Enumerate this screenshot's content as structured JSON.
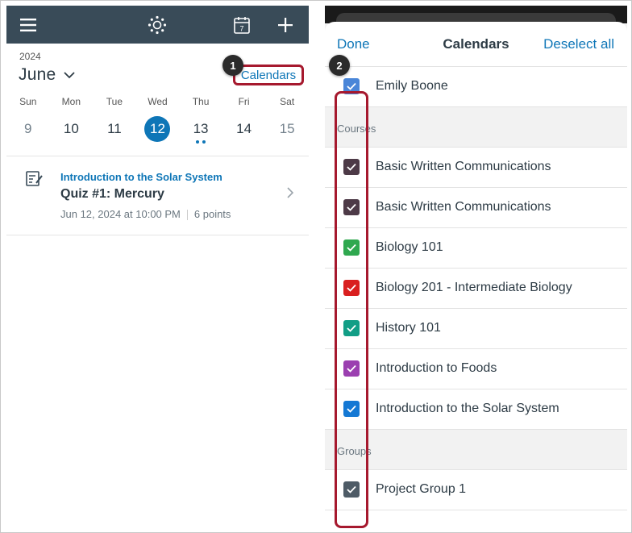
{
  "left": {
    "year": "2024",
    "month": "June",
    "calendars_link": "Calendars",
    "calendar_icon_day": "7",
    "weekdays": [
      "Sun",
      "Mon",
      "Tue",
      "Wed",
      "Thu",
      "Fri",
      "Sat"
    ],
    "days": [
      "9",
      "10",
      "11",
      "12",
      "13",
      "14",
      "15"
    ],
    "selected_day": "12",
    "event": {
      "course": "Introduction to the Solar System",
      "title": "Quiz #1: Mercury",
      "date": "Jun 12, 2024 at 10:00 PM",
      "points": "6 points"
    }
  },
  "right": {
    "done": "Done",
    "title": "Calendars",
    "deselect_all": "Deselect all",
    "user": {
      "label": "Emily Boone",
      "color": "#4a86d8"
    },
    "courses_header": "Courses",
    "courses": [
      {
        "label": "Basic Written Communications",
        "color": "#4d3a47"
      },
      {
        "label": "Basic Written Communications",
        "color": "#4d3a47"
      },
      {
        "label": "Biology 101",
        "color": "#2fa84f"
      },
      {
        "label": "Biology 201 - Intermediate Biology",
        "color": "#d91f1f"
      },
      {
        "label": "History 101",
        "color": "#129e86"
      },
      {
        "label": "Introduction to Foods",
        "color": "#9b3fb0"
      },
      {
        "label": "Introduction to the Solar System",
        "color": "#1478d4"
      }
    ],
    "groups_header": "Groups",
    "groups": [
      {
        "label": "Project Group 1",
        "color": "#4e5b66"
      }
    ]
  },
  "callouts": [
    "1",
    "2"
  ],
  "colors": {
    "accent": "#0e76b7",
    "topbar": "#394b58",
    "highlight": "#a6192e"
  }
}
